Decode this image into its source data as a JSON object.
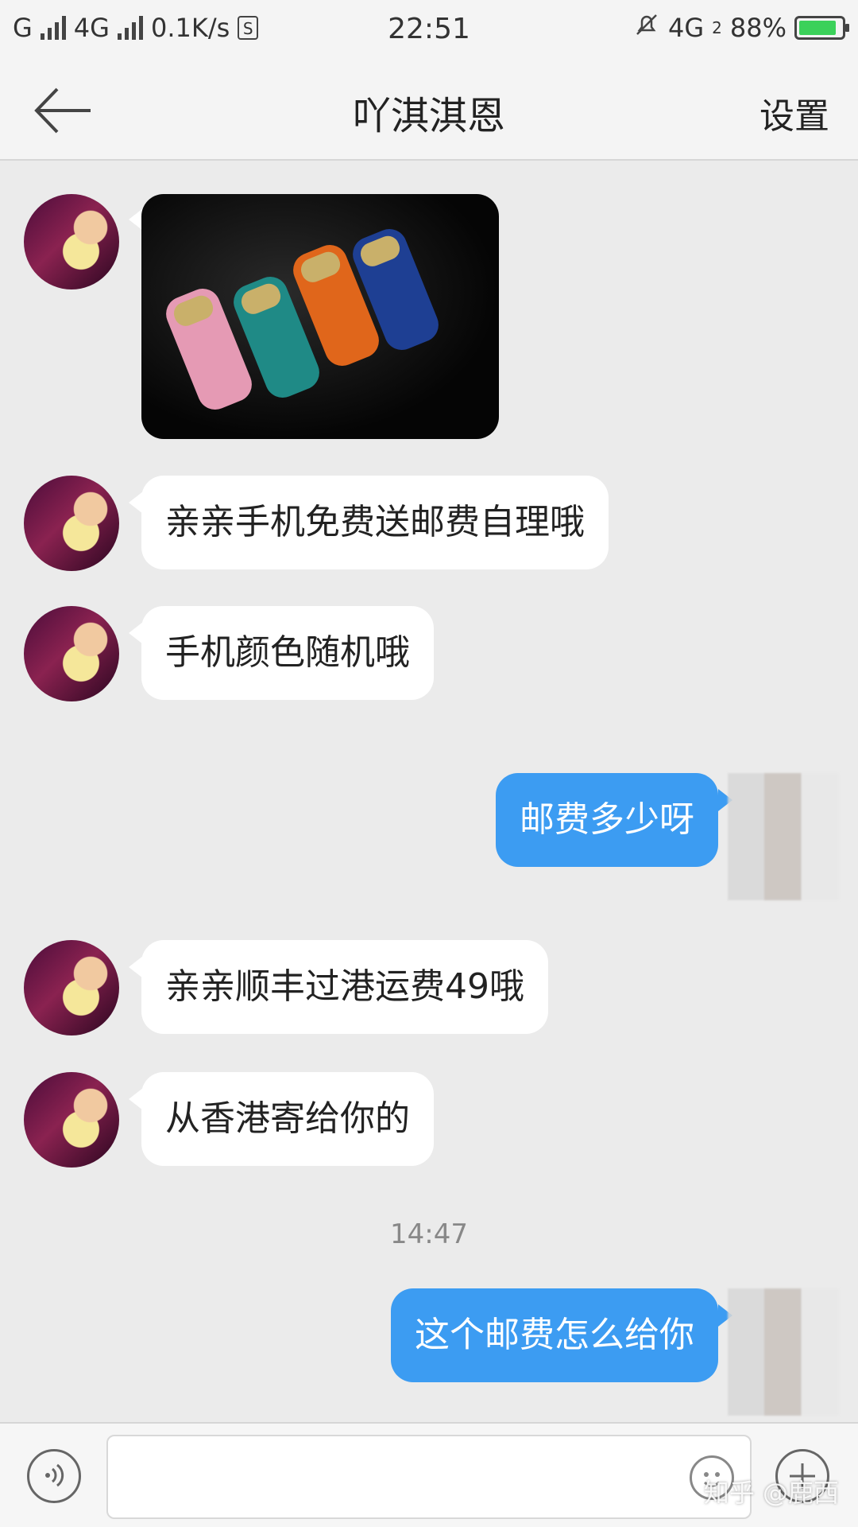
{
  "status_bar": {
    "carrier": "G",
    "network": "4G",
    "speed": "0.1K/s",
    "time": "22:51",
    "network_right": "4G",
    "sim_label": "2",
    "battery": "88%"
  },
  "header": {
    "title": "吖淇淇恩",
    "settings_label": "设置"
  },
  "messages": [
    {
      "from": "other",
      "type": "image"
    },
    {
      "from": "other",
      "text": "亲亲手机免费送邮费自理哦"
    },
    {
      "from": "other",
      "text": "手机颜色随机哦"
    },
    {
      "from": "me",
      "text": "邮费多少呀"
    },
    {
      "from": "other",
      "text": "亲亲顺丰过港运费49哦"
    },
    {
      "from": "other",
      "text": "从香港寄给你的"
    },
    {
      "from": "me",
      "text": "这个邮费怎么给你"
    }
  ],
  "timestamp": "14:47",
  "input": {
    "value": "",
    "placeholder": ""
  },
  "watermark": "知乎 @鹿西",
  "colors": {
    "outgoing_bubble": "#3c9cf2",
    "incoming_bubble": "#ffffff",
    "background": "#ebebeb"
  }
}
